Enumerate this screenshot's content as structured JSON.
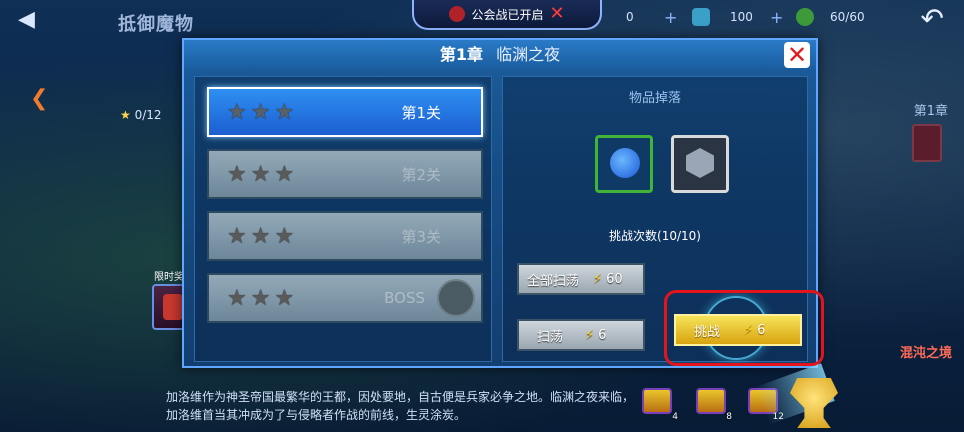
{
  "top_bar": {
    "page_title": "抵御魔物",
    "guild_notice": "公会战已开启",
    "resources": [
      {
        "icon": "gold-coin-icon",
        "value": "0"
      },
      {
        "icon": "gem-icon",
        "value": "100"
      },
      {
        "icon": "energy-icon",
        "value": "60/60"
      }
    ]
  },
  "map": {
    "stars_progress": "0/12",
    "limited_reward_label": "限时奖励",
    "right_chapter_label": "第1章",
    "right_chaos_label": "混沌之境"
  },
  "dialog": {
    "chapter": "第1章",
    "chapter_name": "临渊之夜",
    "stages": [
      {
        "label": "第1关",
        "active": true
      },
      {
        "label": "第2关",
        "active": false
      },
      {
        "label": "第3关",
        "active": false
      },
      {
        "label": "BOSS",
        "active": false
      }
    ],
    "drops_title": "物品掉落",
    "drops": [
      {
        "icon": "mana-potion-icon"
      },
      {
        "icon": "rune-stone-icon"
      }
    ],
    "attempts": "挑战次数(10/10)",
    "sweep_all_label": "全部扫荡",
    "sweep_all_cost": "60",
    "sweep_label": "扫荡",
    "sweep_cost": "6",
    "challenge_label": "挑战",
    "challenge_cost": "6"
  },
  "description": "加洛维作为神圣帝国最繁华的王都，因处要地，自古便是兵家必争之地。临渊之夜来临，加洛维首当其冲成为了与侵略者作战的前线，生灵涂炭。",
  "chests": [
    {
      "count": "4"
    },
    {
      "count": "8"
    },
    {
      "count": "12"
    }
  ],
  "colors": {
    "highlight": "#e5141a",
    "gold_button": "#f6e35a",
    "active_stage": "#2e8ff2"
  }
}
